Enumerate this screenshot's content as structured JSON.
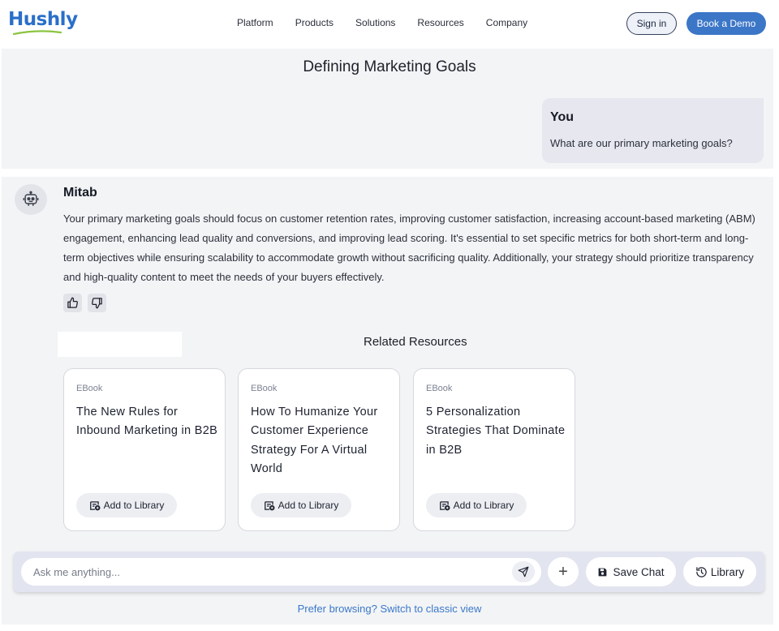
{
  "header": {
    "logo_text": "Hushly",
    "nav": [
      "Platform",
      "Products",
      "Solutions",
      "Resources",
      "Company"
    ],
    "signin_label": "Sign in",
    "demo_label": "Book a Demo",
    "colors": {
      "brand_blue": "#2a6fc9",
      "logo_swoosh": "#8ac440",
      "demo_button": "#3c76c7"
    }
  },
  "chat": {
    "title": "Defining Marketing Goals",
    "user": {
      "name": "You",
      "message": "What are our primary marketing goals?"
    },
    "bot": {
      "avatar_icon": "robot-icon",
      "name": "Mitab",
      "message": "Your primary marketing goals should focus on customer retention rates, improving customer satisfaction, increasing account-based marketing (ABM) engagement, enhancing lead quality and conversions, and improving lead scoring. It's essential to set specific metrics for both short-term and long-term objectives while ensuring scalability to accommodate growth without sacrificing quality. Additionally, your strategy should prioritize transparency and high-quality content to meet the needs of your buyers effectively.",
      "feedback_icons": [
        "thumbs-up-icon",
        "thumbs-down-icon"
      ]
    }
  },
  "related": {
    "title": "Related Resources",
    "cards": [
      {
        "type": "EBook",
        "title": "The New Rules for Inbound Marketing in B2B",
        "button": "Add to Library"
      },
      {
        "type": "EBook",
        "title": "How To Humanize Your Customer Experience Strategy For A Virtual World",
        "button": "Add to Library"
      },
      {
        "type": "EBook",
        "title": "5 Personalization Strategies That Dominate in B2B",
        "button": "Add to Library"
      }
    ]
  },
  "composer": {
    "placeholder": "Ask me anything...",
    "plus_label": "+",
    "save_label": "Save Chat",
    "library_label": "Library"
  },
  "footer": {
    "classic_link": "Prefer browsing? Switch to classic view"
  }
}
